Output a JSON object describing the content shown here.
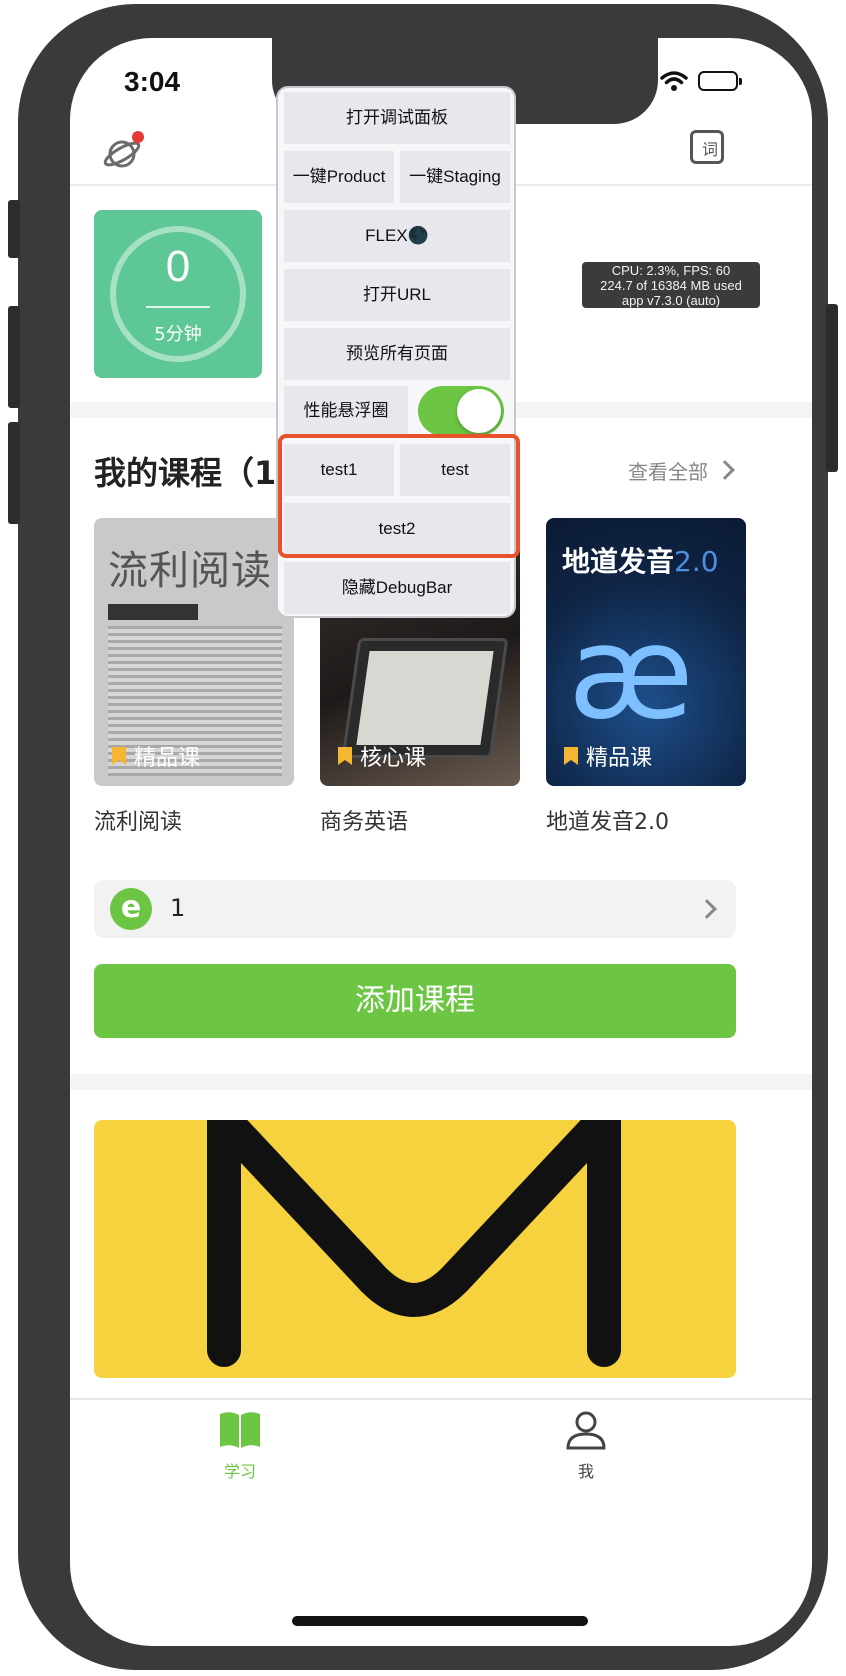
{
  "status_bar": {
    "time": "3:04"
  },
  "nav": {
    "dict_icon_glyph": "词"
  },
  "study_card": {
    "minutes_count": "0",
    "goal_label": "5分钟"
  },
  "perf_overlay": {
    "line1": "CPU: 2.3%, FPS: 60",
    "line2": "224.7 of 16384 MB used",
    "line3": "app v7.3.0 (auto)"
  },
  "courses": {
    "title": "我的课程（17",
    "view_all": "查看全部",
    "items": [
      {
        "name": "流利阅读",
        "badge": "精品课",
        "cover_text": "流利阅读"
      },
      {
        "name": "商务英语",
        "badge": "核心课"
      },
      {
        "name": "地道发音2.0",
        "badge": "精品课",
        "cover_title": "地道发音",
        "cover_version": "2.0",
        "cover_mark": "æ"
      }
    ]
  },
  "book_row": {
    "icon_letter": "e",
    "value": "1"
  },
  "add_course_button": "添加课程",
  "tab_bar": {
    "study_label": "学习",
    "me_label": "我"
  },
  "debug_panel": {
    "open_debug": "打开调试面板",
    "product": "一键Product",
    "staging": "一键Staging",
    "flex": "FLEX🌑",
    "open_url": "打开URL",
    "preview_all": "预览所有页面",
    "perf_bubble": "性能悬浮圈",
    "perf_bubble_on": true,
    "test1": "test1",
    "test": "test",
    "test2": "test2",
    "hide_debugbar": "隐藏DebugBar"
  },
  "colors": {
    "brand_green": "#6cc644",
    "study_green": "#5ec796",
    "highlight_red": "#e8522a",
    "banner_yellow": "#f6d23e"
  }
}
